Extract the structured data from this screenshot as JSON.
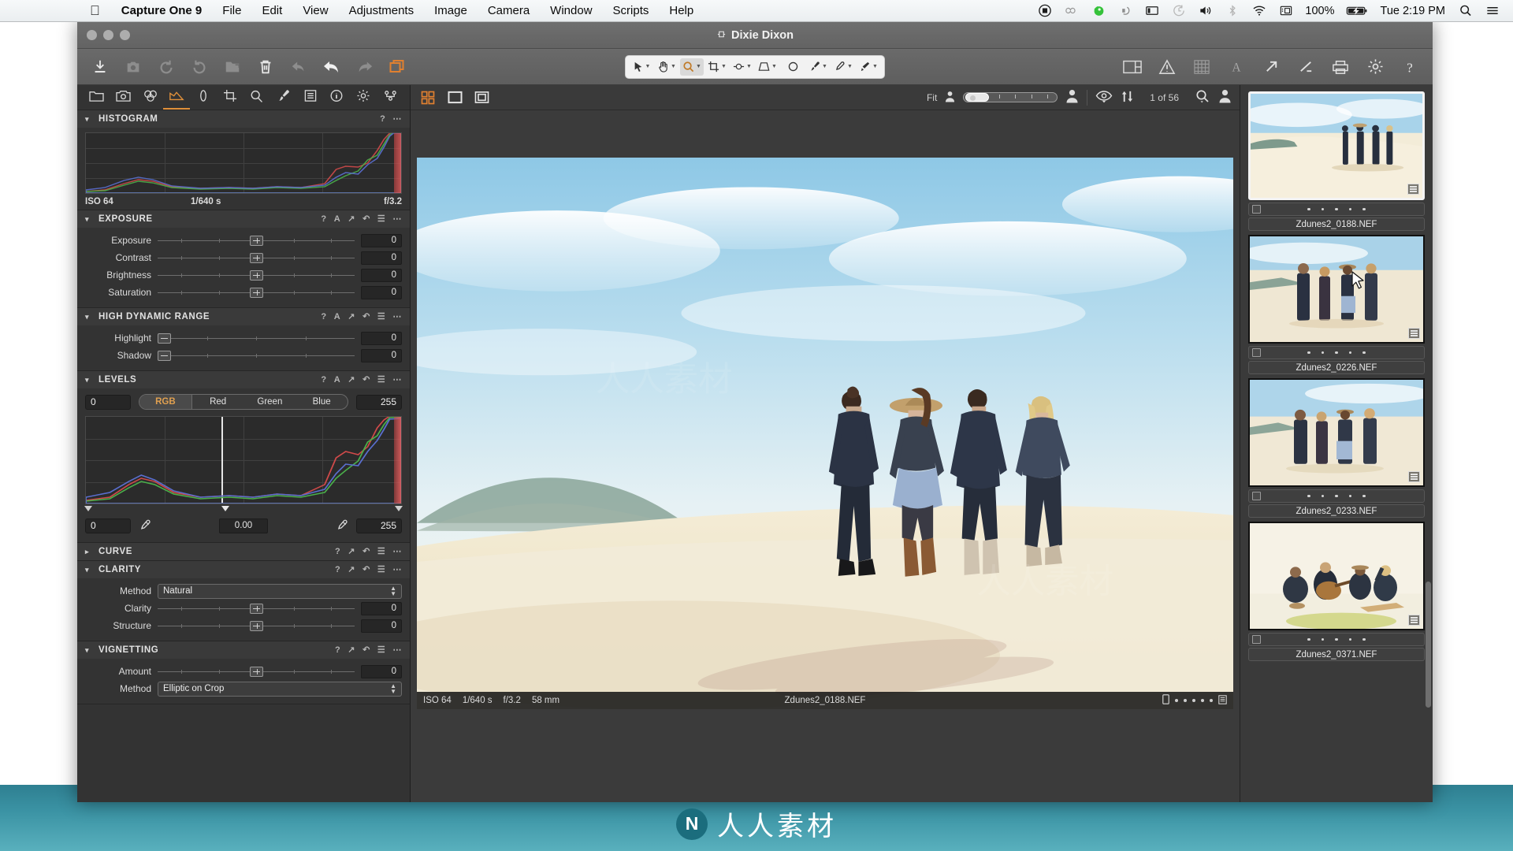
{
  "menubar": {
    "apple_icon": "apple-logo",
    "items": [
      {
        "label": "Capture One 9",
        "bold": true
      },
      {
        "label": "File",
        "bold": false
      },
      {
        "label": "Edit",
        "bold": false
      },
      {
        "label": "View",
        "bold": false
      },
      {
        "label": "Adjustments",
        "bold": false
      },
      {
        "label": "Image",
        "bold": false
      },
      {
        "label": "Camera",
        "bold": false
      },
      {
        "label": "Window",
        "bold": false
      },
      {
        "label": "Scripts",
        "bold": false
      },
      {
        "label": "Help",
        "bold": false
      }
    ],
    "status_icons": [
      "screen-record-icon",
      "creative-cloud-icon",
      "evernote-icon",
      "dropbox-icon",
      "display-icon",
      "time-machine-icon",
      "volume-icon",
      "bluetooth-icon",
      "wifi-icon",
      "input-source-icon"
    ],
    "battery_percent": "100%",
    "battery_icon": "battery-charging-icon",
    "clock": "Tue 2:19 PM",
    "spotlight_icon": "search-icon",
    "notification_icon": "list-icon"
  },
  "window": {
    "title": "Dixie Dixon",
    "title_icon": "tethered-icon",
    "traffic_lights": [
      "close",
      "minimize",
      "zoom"
    ]
  },
  "toolbar": {
    "left_buttons": [
      {
        "name": "import-images-button",
        "icon": "download-icon",
        "state": "normal"
      },
      {
        "name": "capture-button",
        "icon": "camera-icon",
        "state": "dim"
      },
      {
        "name": "rotate-left-button",
        "icon": "rotate-ccw-icon",
        "state": "dim"
      },
      {
        "name": "rotate-right-button",
        "icon": "rotate-cw-icon",
        "state": "dim"
      },
      {
        "name": "new-album-button",
        "icon": "folder-plus-icon",
        "state": "dim"
      },
      {
        "name": "delete-button",
        "icon": "trash-icon",
        "state": "normal"
      },
      {
        "name": "reset-button",
        "icon": "reset-arrow-icon",
        "state": "dim"
      },
      {
        "name": "undo-button",
        "icon": "undo-icon",
        "state": "normal"
      },
      {
        "name": "redo-button",
        "icon": "redo-icon",
        "state": "dim"
      },
      {
        "name": "copy-apply-button",
        "icon": "layers-icon",
        "state": "accent"
      }
    ],
    "center_tools": [
      {
        "name": "select-tool",
        "icon": "cursor-icon",
        "selected": false,
        "has_caret": true
      },
      {
        "name": "pan-tool",
        "icon": "hand-icon",
        "selected": false,
        "has_caret": true
      },
      {
        "name": "zoom-tool",
        "icon": "magnifier-icon",
        "selected": true,
        "has_caret": true
      },
      {
        "name": "crop-tool",
        "icon": "crop-icon",
        "selected": false,
        "has_caret": true
      },
      {
        "name": "rotate-tool",
        "icon": "rotate-crop-icon",
        "selected": false,
        "has_caret": true
      },
      {
        "name": "keystone-tool",
        "icon": "keystone-icon",
        "selected": false,
        "has_caret": true
      },
      {
        "name": "spot-removal-tool",
        "icon": "spot-circle-icon",
        "selected": false,
        "has_caret": false
      },
      {
        "name": "draw-mask-tool",
        "icon": "brush-icon",
        "selected": false,
        "has_caret": true
      },
      {
        "name": "color-picker-tool",
        "icon": "eyedropper-icon",
        "selected": false,
        "has_caret": true
      },
      {
        "name": "gradient-mask-tool",
        "icon": "gradient-brush-icon",
        "selected": false,
        "has_caret": true
      }
    ],
    "right_buttons": [
      {
        "name": "viewer-layout-button",
        "icon": "viewer-grid-icon"
      },
      {
        "name": "exposure-warning-button",
        "icon": "warning-triangle-icon"
      },
      {
        "name": "focus-mask-button",
        "icon": "focus-mask-icon"
      },
      {
        "name": "annotations-button",
        "icon": "letter-a-icon"
      },
      {
        "name": "export-button",
        "icon": "export-arrow-icon"
      },
      {
        "name": "process-button",
        "icon": "process-check-icon"
      },
      {
        "name": "print-button",
        "icon": "printer-icon"
      },
      {
        "name": "preferences-button",
        "icon": "gear-icon"
      },
      {
        "name": "help-button",
        "icon": "question-icon"
      }
    ]
  },
  "tool_tabs": [
    {
      "name": "library-tab",
      "icon": "folder-icon",
      "active": false
    },
    {
      "name": "capture-tab",
      "icon": "camera-icon",
      "active": false
    },
    {
      "name": "color-tab",
      "icon": "color-circles-icon",
      "active": false
    },
    {
      "name": "exposure-tab",
      "icon": "exposure-icon",
      "active": true
    },
    {
      "name": "lens-tab",
      "icon": "lens-icon",
      "active": false
    },
    {
      "name": "composition-tab",
      "icon": "crop-icon",
      "active": false
    },
    {
      "name": "details-tab",
      "icon": "magnifier-icon",
      "active": false
    },
    {
      "name": "local-adjustments-tab",
      "icon": "brush-icon",
      "active": false
    },
    {
      "name": "adjustments-tab",
      "icon": "list-icon",
      "active": false
    },
    {
      "name": "metadata-tab",
      "icon": "info-icon",
      "active": false
    },
    {
      "name": "output-tab",
      "icon": "gear-icon",
      "active": false
    },
    {
      "name": "batch-tab",
      "icon": "batch-icon",
      "active": false
    }
  ],
  "tools": {
    "histogram": {
      "title": "HISTOGRAM",
      "expanded": true,
      "header_buttons": [
        "help-icon",
        "menu-dots-icon"
      ],
      "exif": {
        "iso": "ISO 64",
        "shutter": "1/640 s",
        "aperture": "f/3.2"
      }
    },
    "exposure": {
      "title": "EXPOSURE",
      "expanded": true,
      "header_buttons": [
        "help-icon",
        "auto-icon",
        "copy-icon",
        "reset-icon",
        "menu-icon",
        "dots-icon"
      ],
      "sliders": [
        {
          "label": "Exposure",
          "value": "0",
          "knob_pct": 50
        },
        {
          "label": "Contrast",
          "value": "0",
          "knob_pct": 50
        },
        {
          "label": "Brightness",
          "value": "0",
          "knob_pct": 50
        },
        {
          "label": "Saturation",
          "value": "0",
          "knob_pct": 50
        }
      ]
    },
    "hdr": {
      "title": "HIGH DYNAMIC RANGE",
      "expanded": true,
      "header_buttons": [
        "help-icon",
        "auto-icon",
        "copy-icon",
        "reset-icon",
        "menu-icon",
        "dots-icon"
      ],
      "sliders": [
        {
          "label": "Highlight",
          "value": "0",
          "knob_pct": 0
        },
        {
          "label": "Shadow",
          "value": "0",
          "knob_pct": 0
        }
      ]
    },
    "levels": {
      "title": "LEVELS",
      "expanded": true,
      "header_buttons": [
        "help-icon",
        "auto-icon",
        "copy-icon",
        "reset-icon",
        "menu-icon",
        "dots-icon"
      ],
      "input_low": "0",
      "input_high": "255",
      "channels": [
        {
          "label": "RGB",
          "active": true
        },
        {
          "label": "Red",
          "active": false
        },
        {
          "label": "Green",
          "active": false
        },
        {
          "label": "Blue",
          "active": false
        }
      ],
      "output_low": "0",
      "output_mid": "0.00",
      "output_high": "255",
      "picker_low_icon": "eyedropper-icon",
      "picker_high_icon": "eyedropper-icon"
    },
    "curve": {
      "title": "CURVE",
      "expanded": false,
      "header_buttons": [
        "help-icon",
        "copy-icon",
        "reset-icon",
        "menu-icon",
        "dots-icon"
      ]
    },
    "clarity": {
      "title": "CLARITY",
      "expanded": true,
      "header_buttons": [
        "help-icon",
        "copy-icon",
        "reset-icon",
        "menu-icon",
        "dots-icon"
      ],
      "method_label": "Method",
      "method_value": "Natural",
      "sliders": [
        {
          "label": "Clarity",
          "value": "0",
          "knob_pct": 50
        },
        {
          "label": "Structure",
          "value": "0",
          "knob_pct": 50
        }
      ]
    },
    "vignetting": {
      "title": "VIGNETTING",
      "expanded": true,
      "header_buttons": [
        "help-icon",
        "copy-icon",
        "reset-icon",
        "menu-icon",
        "dots-icon"
      ],
      "sliders": [
        {
          "label": "Amount",
          "value": "0",
          "knob_pct": 50
        }
      ],
      "method_label": "Method",
      "method_value": "Elliptic on Crop"
    }
  },
  "viewer": {
    "layout_buttons": [
      {
        "name": "browser-grid-button",
        "icon": "grid-icon",
        "accent": true
      },
      {
        "name": "single-view-button",
        "icon": "square-icon",
        "accent": false
      },
      {
        "name": "proof-view-button",
        "icon": "double-square-icon",
        "accent": false
      }
    ],
    "zoom_label": "Fit",
    "zoom_min_icon": "person-small-icon",
    "zoom_max_icon": "person-large-icon",
    "zoom_knob_pct": 4,
    "eye_icon": "eye-compare-icon",
    "sort_icon": "sort-updown-icon",
    "counter": "1 of 56",
    "search_icon": "search-filter-icon",
    "person_icon": "person-icon",
    "info_bar": {
      "iso": "ISO 64",
      "shutter": "1/640 s",
      "aperture": "f/3.2",
      "focal": "58 mm",
      "filename": "Zdunes2_0188.NEF",
      "badge_icon": "mobile-icon",
      "rating_dots": 5,
      "list_icon": "list-badge-icon"
    }
  },
  "filmstrip": {
    "items": [
      {
        "filename": "Zdunes2_0188.NEF",
        "selected": true,
        "rating_dots": 5,
        "scene": "dune-four-walking-wide"
      },
      {
        "filename": "Zdunes2_0226.NEF",
        "selected": false,
        "rating_dots": 5,
        "scene": "dune-four-walking-close"
      },
      {
        "filename": "Zdunes2_0233.NEF",
        "selected": false,
        "rating_dots": 5,
        "scene": "dune-four-group"
      },
      {
        "filename": "Zdunes2_0371.NEF",
        "selected": false,
        "rating_dots": 5,
        "scene": "campfire-guitar-group"
      }
    ]
  },
  "watermark": {
    "brand": "人人素材",
    "logo_letter": "N"
  },
  "colors": {
    "accent": "#e08030",
    "panel_bg": "#333333",
    "toolbar_bg": "#656565",
    "viewer_bg": "#3b3b3b",
    "levels_active": "#e0a050"
  }
}
